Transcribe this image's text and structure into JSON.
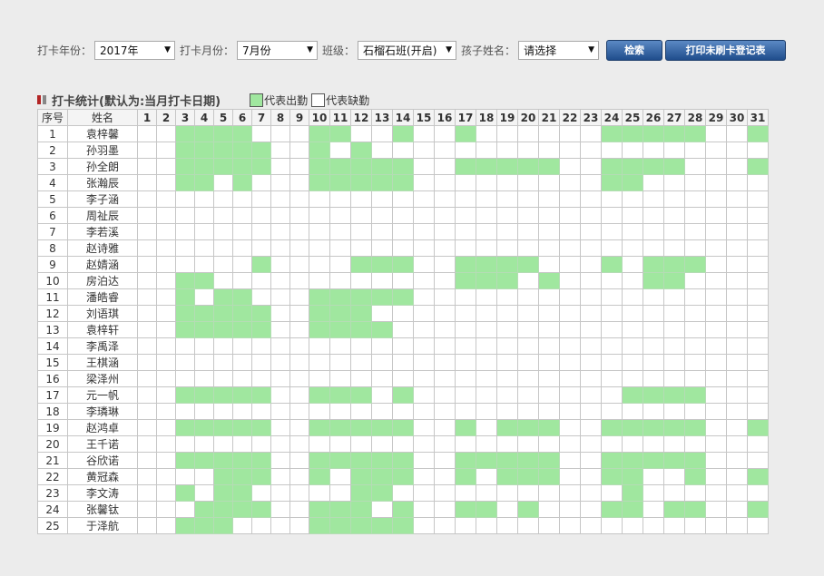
{
  "filters": {
    "year_label": "打卡年份：",
    "year_value": "2017年",
    "month_label": "打卡月份：",
    "month_value": "7月份",
    "class_label": "班级：",
    "class_value": "石榴石班(开启)",
    "child_label": "孩子姓名：",
    "child_value": "请选择",
    "search_button": "检索",
    "print_button": "打印未刷卡登记表"
  },
  "legend": {
    "title": "打卡统计(默认为:当月打卡日期)",
    "present_label": "代表出勤",
    "absent_label": "代表缺勤",
    "present_color": "#a0e79f",
    "absent_color": "#ffffff",
    "title_marker_color": "#b32525"
  },
  "table": {
    "headers": {
      "index": "序号",
      "name": "姓名"
    },
    "days": [
      "1",
      "2",
      "3",
      "4",
      "5",
      "6",
      "7",
      "8",
      "9",
      "10",
      "11",
      "12",
      "13",
      "14",
      "15",
      "16",
      "17",
      "18",
      "19",
      "20",
      "21",
      "22",
      "23",
      "24",
      "25",
      "26",
      "27",
      "28",
      "29",
      "30",
      "31"
    ],
    "rows": [
      {
        "no": "1",
        "name": "袁梓馨",
        "present": [
          3,
          4,
          5,
          6,
          10,
          11,
          14,
          17,
          24,
          25,
          26,
          27,
          28,
          31
        ]
      },
      {
        "no": "2",
        "name": "孙羽墨",
        "present": [
          3,
          4,
          5,
          6,
          7,
          10,
          12
        ]
      },
      {
        "no": "3",
        "name": "孙全朗",
        "present": [
          3,
          4,
          5,
          6,
          7,
          10,
          11,
          12,
          13,
          14,
          17,
          18,
          19,
          20,
          21,
          24,
          25,
          26,
          27,
          31
        ]
      },
      {
        "no": "4",
        "name": "张瀚辰",
        "present": [
          3,
          4,
          6,
          10,
          11,
          12,
          13,
          14,
          24,
          25
        ]
      },
      {
        "no": "5",
        "name": "李子涵",
        "present": []
      },
      {
        "no": "6",
        "name": "周祉辰",
        "present": []
      },
      {
        "no": "7",
        "name": "李若溪",
        "present": []
      },
      {
        "no": "8",
        "name": "赵诗雅",
        "present": []
      },
      {
        "no": "9",
        "name": "赵婧涵",
        "present": [
          7,
          12,
          13,
          14,
          17,
          18,
          19,
          20,
          24,
          26,
          27,
          28
        ]
      },
      {
        "no": "10",
        "name": "房泊达",
        "present": [
          3,
          4,
          17,
          18,
          19,
          21,
          26,
          27
        ]
      },
      {
        "no": "11",
        "name": "潘皓睿",
        "present": [
          3,
          5,
          6,
          10,
          11,
          12,
          13,
          14
        ]
      },
      {
        "no": "12",
        "name": "刘语琪",
        "present": [
          3,
          4,
          5,
          6,
          7,
          10,
          11,
          12
        ]
      },
      {
        "no": "13",
        "name": "袁梓轩",
        "present": [
          3,
          4,
          5,
          6,
          7,
          10,
          11,
          12,
          13
        ]
      },
      {
        "no": "14",
        "name": "李禹泽",
        "present": []
      },
      {
        "no": "15",
        "name": "王棋涵",
        "present": []
      },
      {
        "no": "16",
        "name": "梁泽州",
        "present": []
      },
      {
        "no": "17",
        "name": "元一帆",
        "present": [
          3,
          4,
          5,
          6,
          7,
          10,
          11,
          12,
          14,
          25,
          26,
          27,
          28
        ]
      },
      {
        "no": "18",
        "name": "李璘琳",
        "present": []
      },
      {
        "no": "19",
        "name": "赵鸿卓",
        "present": [
          3,
          4,
          5,
          6,
          7,
          10,
          11,
          12,
          13,
          14,
          17,
          19,
          20,
          21,
          24,
          25,
          26,
          27,
          28,
          31
        ]
      },
      {
        "no": "20",
        "name": "王千诺",
        "present": []
      },
      {
        "no": "21",
        "name": "谷欣诺",
        "present": [
          3,
          4,
          5,
          6,
          7,
          10,
          11,
          12,
          13,
          14,
          17,
          18,
          19,
          20,
          21,
          24,
          25,
          26,
          27,
          28
        ]
      },
      {
        "no": "22",
        "name": "黄冠森",
        "present": [
          5,
          6,
          7,
          10,
          12,
          13,
          14,
          17,
          19,
          20,
          21,
          24,
          25,
          28,
          31
        ]
      },
      {
        "no": "23",
        "name": "李文涛",
        "present": [
          3,
          5,
          6,
          12,
          13,
          25
        ]
      },
      {
        "no": "24",
        "name": "张馨钛",
        "present": [
          4,
          5,
          6,
          7,
          10,
          11,
          12,
          14,
          17,
          18,
          20,
          24,
          25,
          27,
          28,
          31
        ]
      },
      {
        "no": "25",
        "name": "于泽航",
        "present": [
          3,
          4,
          5,
          10,
          11,
          12,
          13,
          14
        ]
      }
    ]
  }
}
